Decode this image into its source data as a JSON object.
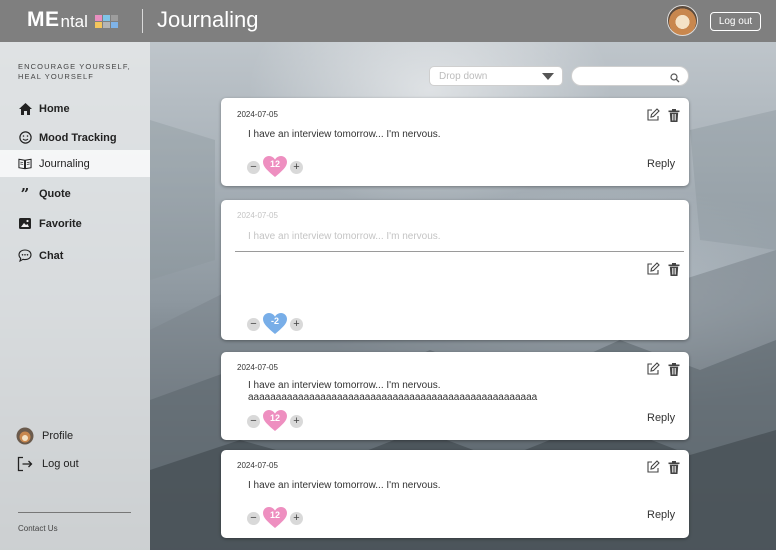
{
  "header": {
    "logo_bold": "ME",
    "logo_rest": "ntal",
    "logo_colors": [
      "#e98fc0",
      "#7fc4e8",
      "#9d9d9d",
      "#f4c55c",
      "#b5b5b5",
      "#7fb3e8"
    ],
    "title": "Journaling",
    "logout_label": "Log out"
  },
  "sidebar": {
    "tagline_line1": "ENCOURAGE YOURSELF,",
    "tagline_line2": "HEAL YOURSELF",
    "items": [
      {
        "label": "Home",
        "icon": "home-icon"
      },
      {
        "label": "Mood Tracking",
        "icon": "smiley-icon"
      },
      {
        "label": "Journaling",
        "icon": "book-icon",
        "active": true
      },
      {
        "label": "Quote",
        "icon": "quote-icon"
      },
      {
        "label": "Favorite",
        "icon": "image-icon"
      },
      {
        "label": "Chat",
        "icon": "chat-bubble-icon"
      }
    ],
    "profile_label": "Profile",
    "logout_label": "Log out",
    "contact_label": "Contact Us"
  },
  "controls": {
    "dropdown_placeholder": "Drop down",
    "search_value": ""
  },
  "colors": {
    "heart_positive": "#ee8fc0",
    "heart_negative": "#78aee8",
    "header": "#7f7f7f"
  },
  "entries": [
    {
      "date": "2024-07-05",
      "text": "I have an interview tomorrow... I'm nervous.",
      "votes": "12",
      "heart": "positive",
      "reply_label": "Reply"
    },
    {
      "date": "2024-07-05",
      "text": "I have an interview tomorrow... I'm nervous.",
      "votes": "-2",
      "heart": "negative",
      "editing": true
    },
    {
      "date": "2024-07-05",
      "text": "I have an interview tomorrow... I'm nervous.\naaaaaaaaaaaaaaaaaaaaaaaaaaaaaaaaaaaaaaaaaaaaaaaaaaaa",
      "votes": "12",
      "heart": "positive",
      "reply_label": "Reply"
    },
    {
      "date": "2024-07-05",
      "text": "I have an interview tomorrow... I'm nervous.",
      "votes": "12",
      "heart": "positive",
      "reply_label": "Reply"
    }
  ]
}
